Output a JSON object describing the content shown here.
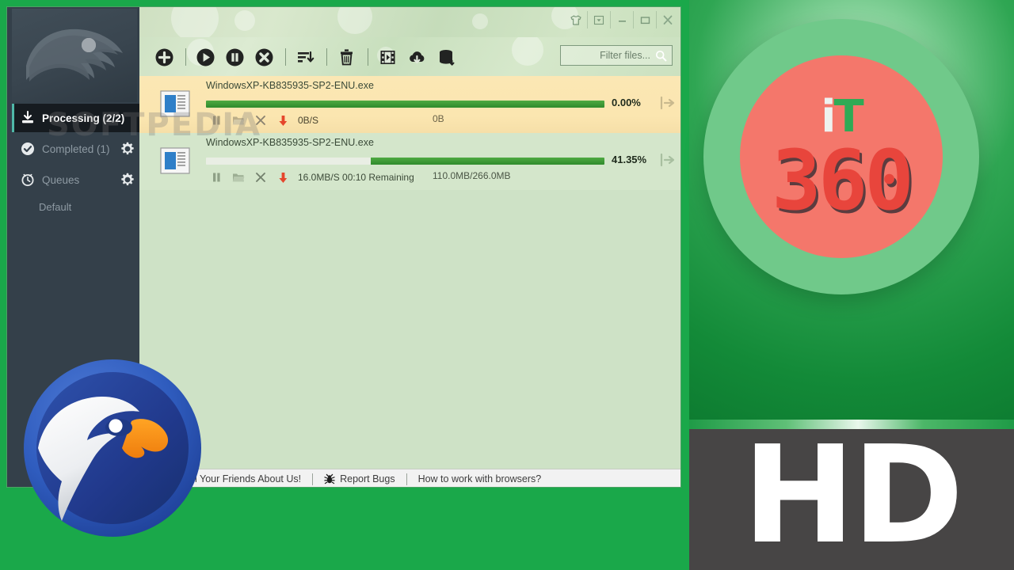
{
  "window": {
    "title_buttons": [
      {
        "name": "skin-button",
        "glyph": "☂"
      },
      {
        "name": "dropdown-button",
        "glyph": "▾"
      },
      {
        "name": "minimize-button",
        "glyph": "—"
      },
      {
        "name": "maximize-button",
        "glyph": "▭"
      },
      {
        "name": "close-button",
        "glyph": "✕"
      }
    ]
  },
  "sidebar": {
    "items": [
      {
        "label": "Processing (2/2)",
        "icon": "download-tray-icon",
        "active": true,
        "gear": false
      },
      {
        "label": "Completed (1)",
        "icon": "check-circle-icon",
        "active": false,
        "gear": true
      },
      {
        "label": "Queues",
        "icon": "clock-icon",
        "active": false,
        "gear": true
      }
    ],
    "sub_item": "Default"
  },
  "toolbar": {
    "buttons": [
      {
        "name": "add-download-button",
        "icon": "plus-circle-icon"
      },
      {
        "name": "start-download-button",
        "icon": "play-circle-icon"
      },
      {
        "name": "pause-download-button",
        "icon": "pause-circle-icon"
      },
      {
        "name": "stop-download-button",
        "icon": "stop-circle-icon"
      },
      {
        "name": "sort-queue-button",
        "icon": "sort-descending-icon"
      },
      {
        "name": "delete-button",
        "icon": "trash-icon"
      },
      {
        "name": "media-grabber-button",
        "icon": "film-icon"
      },
      {
        "name": "cloud-download-button",
        "icon": "cloud-download-icon"
      },
      {
        "name": "batch-download-button",
        "icon": "database-download-icon"
      }
    ]
  },
  "search": {
    "placeholder": "Filter files...",
    "value": "",
    "icon": "search-icon"
  },
  "downloads": [
    {
      "filename": "WindowsXP-KB835935-SP2-ENU.exe",
      "percent_label": "0.00%",
      "percent_value": 100,
      "bar_mode": "full",
      "speed": "0B/S",
      "size": "0B",
      "selected": true,
      "filetype_icon": "exe-file-icon",
      "actions": [
        {
          "name": "row-pause-button",
          "icon": "pause-icon"
        },
        {
          "name": "row-open-folder-button",
          "icon": "folder-icon"
        },
        {
          "name": "row-cancel-button",
          "icon": "close-icon"
        },
        {
          "name": "row-download-indicator",
          "icon": "down-arrow-icon"
        }
      ]
    },
    {
      "filename": "WindowsXP-KB835935-SP2-ENU.exe",
      "percent_label": "41.35%",
      "percent_value": 41.35,
      "bar_mode": "right",
      "speed": "16.0MB/S 00:10 Remaining",
      "size": "110.0MB/266.0MB",
      "selected": false,
      "filetype_icon": "exe-file-icon",
      "actions": [
        {
          "name": "row-pause-button",
          "icon": "pause-icon"
        },
        {
          "name": "row-open-folder-button",
          "icon": "folder-icon"
        },
        {
          "name": "row-cancel-button",
          "icon": "close-icon"
        },
        {
          "name": "row-download-indicator",
          "icon": "down-arrow-icon"
        }
      ]
    }
  ],
  "statusbar": {
    "tell_friends": "Tell Your Friends About Us!",
    "report_bugs": "Report Bugs",
    "browsers_help": "How to work with browsers?",
    "bug_icon": "bug-icon"
  },
  "watermarks": {
    "softpedia": "SOFTPEDIA",
    "hd": "HD"
  },
  "badge": {
    "letter_i": "i",
    "letter_t": "T",
    "number": "360"
  },
  "colors": {
    "brand_green": "#1aa84a",
    "accent_teal": "#4fb8a8",
    "progress_green": "#3f9a35",
    "selected_row": "#fbe6b0",
    "list_bg": "#cee2c6",
    "sidebar_bg": "#34404a",
    "badge_red": "#f4776b",
    "badge_green": "#70c98a",
    "hd_panel": "#474545"
  }
}
